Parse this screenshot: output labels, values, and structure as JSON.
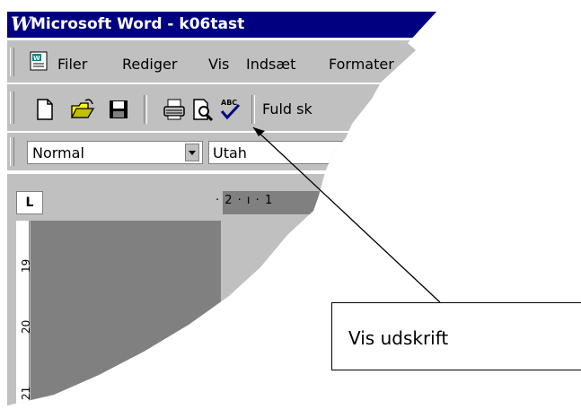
{
  "window": {
    "title": "Microsoft Word - k06tast",
    "logo_letter": "W"
  },
  "menu": {
    "items": [
      {
        "label": "Filer"
      },
      {
        "label": "Rediger"
      },
      {
        "label": "Vis"
      },
      {
        "label": "Indsæt"
      },
      {
        "label": "Formater"
      }
    ]
  },
  "toolbar": {
    "buttons": [
      "new-document",
      "open",
      "save",
      "print",
      "print-preview",
      "spelling-check"
    ],
    "fullscreen_label": "Fuld sk"
  },
  "format": {
    "style_value": "Normal",
    "font_value": "Utah"
  },
  "ruler": {
    "tab_marker": "L",
    "horizontal_text": "· 2 · ı · 1",
    "vertical_numbers": [
      "19",
      "20",
      "21"
    ]
  },
  "callout": {
    "text": "Vis udskrift"
  },
  "colors": {
    "title_bar": "#000080",
    "chrome": "#c0c0c0",
    "shadow": "#808080"
  }
}
